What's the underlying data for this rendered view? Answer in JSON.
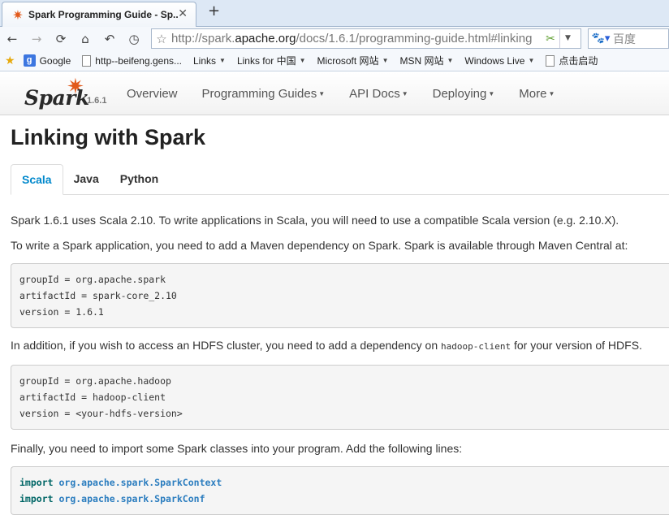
{
  "browser": {
    "tab_title": "Spark Programming Guide - Sp...",
    "tab_close": "✕",
    "new_tab": "+",
    "url_prefix": "http://spark.",
    "url_domain": "apache.org",
    "url_path": "/docs/1.6.1/programming-guide.html#linking",
    "search_placeholder": "百度"
  },
  "bookmarks": [
    {
      "label": "Google",
      "icon": "google-icon"
    },
    {
      "label": "http--beifeng.gens...",
      "icon": "page-icon"
    },
    {
      "label": "Links",
      "icon": "",
      "menu": true
    },
    {
      "label": "Links for 中国",
      "icon": "",
      "menu": true
    },
    {
      "label": "Microsoft 网站",
      "icon": "",
      "menu": true
    },
    {
      "label": "MSN 网站",
      "icon": "",
      "menu": true
    },
    {
      "label": "Windows Live",
      "icon": "",
      "menu": true
    },
    {
      "label": "点击启动",
      "icon": "page-icon"
    }
  ],
  "site": {
    "logo_word": "Spark",
    "version": "1.6.1",
    "nav": [
      {
        "label": "Overview",
        "menu": false
      },
      {
        "label": "Programming Guides",
        "menu": true
      },
      {
        "label": "API Docs",
        "menu": true
      },
      {
        "label": "Deploying",
        "menu": true
      },
      {
        "label": "More",
        "menu": true
      }
    ]
  },
  "content": {
    "heading": "Linking with Spark",
    "tabs": [
      "Scala",
      "Java",
      "Python"
    ],
    "active_tab": "Scala",
    "p1": "Spark 1.6.1 uses Scala 2.10. To write applications in Scala, you will need to use a compatible Scala version (e.g. 2.10.X).",
    "p2": "To write a Spark application, you need to add a Maven dependency on Spark. Spark is available through Maven Central at:",
    "code1": "groupId = org.apache.spark\nartifactId = spark-core_2.10\nversion = 1.6.1",
    "p3_before": "In addition, if you wish to access an HDFS cluster, you need to add a dependency on ",
    "p3_code": "hadoop-client",
    "p3_after": " for your version of HDFS.",
    "code2": "groupId = org.apache.hadoop\nartifactId = hadoop-client\nversion = <your-hdfs-version>",
    "p4": "Finally, you need to import some Spark classes into your program. Add the following lines:",
    "imports": [
      {
        "keyword": "import",
        "name": "org.apache.spark.SparkContext"
      },
      {
        "keyword": "import",
        "name": "org.apache.spark.SparkConf"
      }
    ]
  },
  "colors": {
    "brand_orange": "#e25a1c",
    "link_blue": "#0088cc"
  }
}
